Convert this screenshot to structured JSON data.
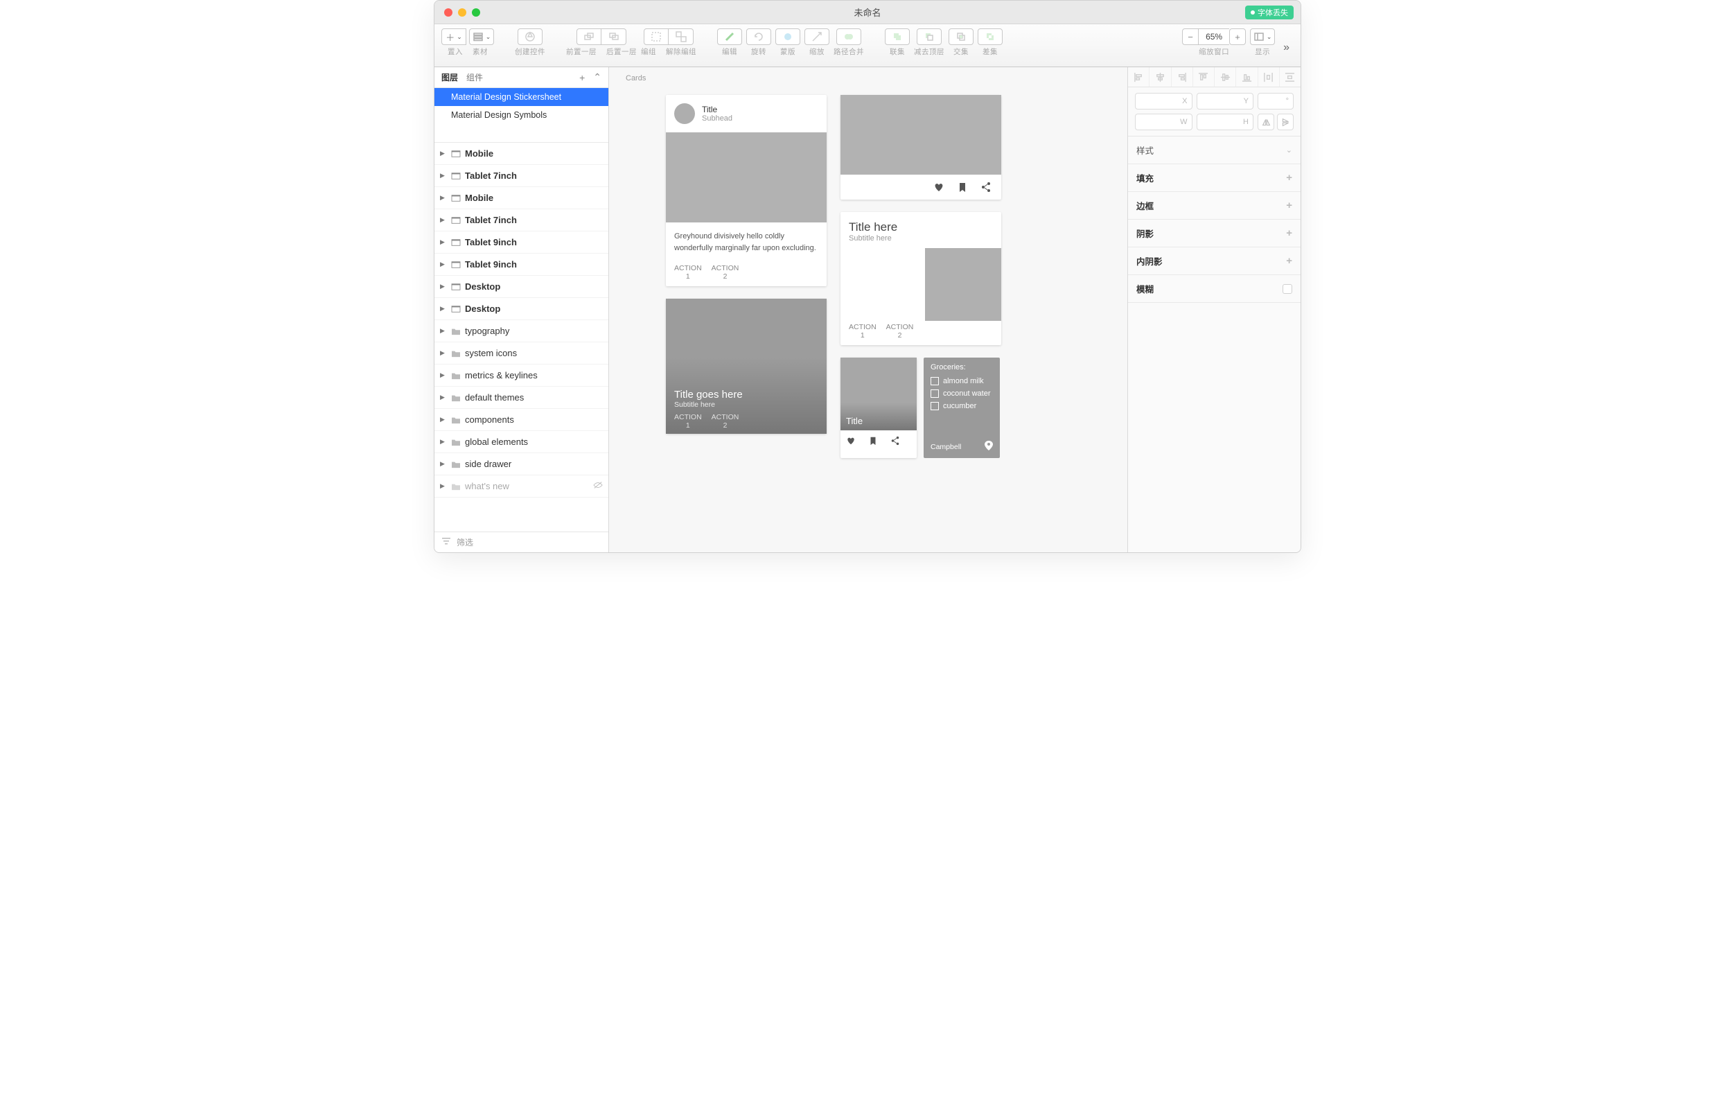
{
  "window": {
    "title": "未命名",
    "badge": "字体丢失"
  },
  "toolbar": {
    "insert_label": "置入",
    "assets_label": "素材",
    "create_symbol": "创建控件",
    "forward": "前置一层",
    "backward": "后置一层",
    "group": "编组",
    "ungroup": "解除编组",
    "edit": "编辑",
    "rotate": "旋转",
    "mask": "蒙版",
    "scale": "缩放",
    "flatten": "路径合并",
    "union": "联集",
    "subtract": "减去顶层",
    "intersect": "交集",
    "difference": "差集",
    "zoom_label": "缩放窗口",
    "zoom_value": "65%",
    "view_label": "显示"
  },
  "pagebar": {
    "layers_tab": "图层",
    "components_tab": "组件"
  },
  "pages": [
    {
      "name": "Material Design Stickersheet",
      "selected": true
    },
    {
      "name": "Material Design Symbols",
      "selected": false
    }
  ],
  "layers_artboards": [
    {
      "name": "Mobile"
    },
    {
      "name": "Tablet 7inch"
    },
    {
      "name": "Mobile"
    },
    {
      "name": "Tablet 7inch"
    },
    {
      "name": "Tablet 9inch"
    },
    {
      "name": "Tablet 9inch"
    },
    {
      "name": "Desktop"
    },
    {
      "name": "Desktop"
    }
  ],
  "layers_folders": [
    {
      "name": "typography"
    },
    {
      "name": "system icons"
    },
    {
      "name": "metrics & keylines"
    },
    {
      "name": "default themes"
    },
    {
      "name": "components"
    },
    {
      "name": "global elements"
    },
    {
      "name": "side drawer"
    },
    {
      "name": "what's new",
      "hidden": true
    }
  ],
  "filter_label": "筛选",
  "canvas": {
    "artboard_label": "Cards"
  },
  "card1": {
    "title": "Title",
    "subhead": "Subhead",
    "body": "Greyhound divisively hello coldly wonderfully marginally far upon excluding.",
    "action1": "ACTION",
    "action1n": "1",
    "action2": "ACTION",
    "action2n": "2"
  },
  "card2": {
    "title": "Title goes here",
    "subtitle": "Subtitle here",
    "action1": "ACTION",
    "action1n": "1",
    "action2": "ACTION",
    "action2n": "2"
  },
  "card4": {
    "title": "Title here",
    "subtitle": "Subtitle here",
    "action1": "ACTION",
    "action1n": "1",
    "action2": "ACTION",
    "action2n": "2"
  },
  "card5": {
    "title": "Title"
  },
  "card6": {
    "heading": "Groceries:",
    "items": [
      "almond milk",
      "coconut water",
      "cucumber"
    ],
    "location": "Campbell"
  },
  "inspector": {
    "x": "X",
    "y": "Y",
    "deg": "°",
    "w": "W",
    "h": "H",
    "style": "样式",
    "fill": "填充",
    "border": "边框",
    "shadow": "阴影",
    "inner_shadow": "内阴影",
    "blur": "模糊"
  }
}
